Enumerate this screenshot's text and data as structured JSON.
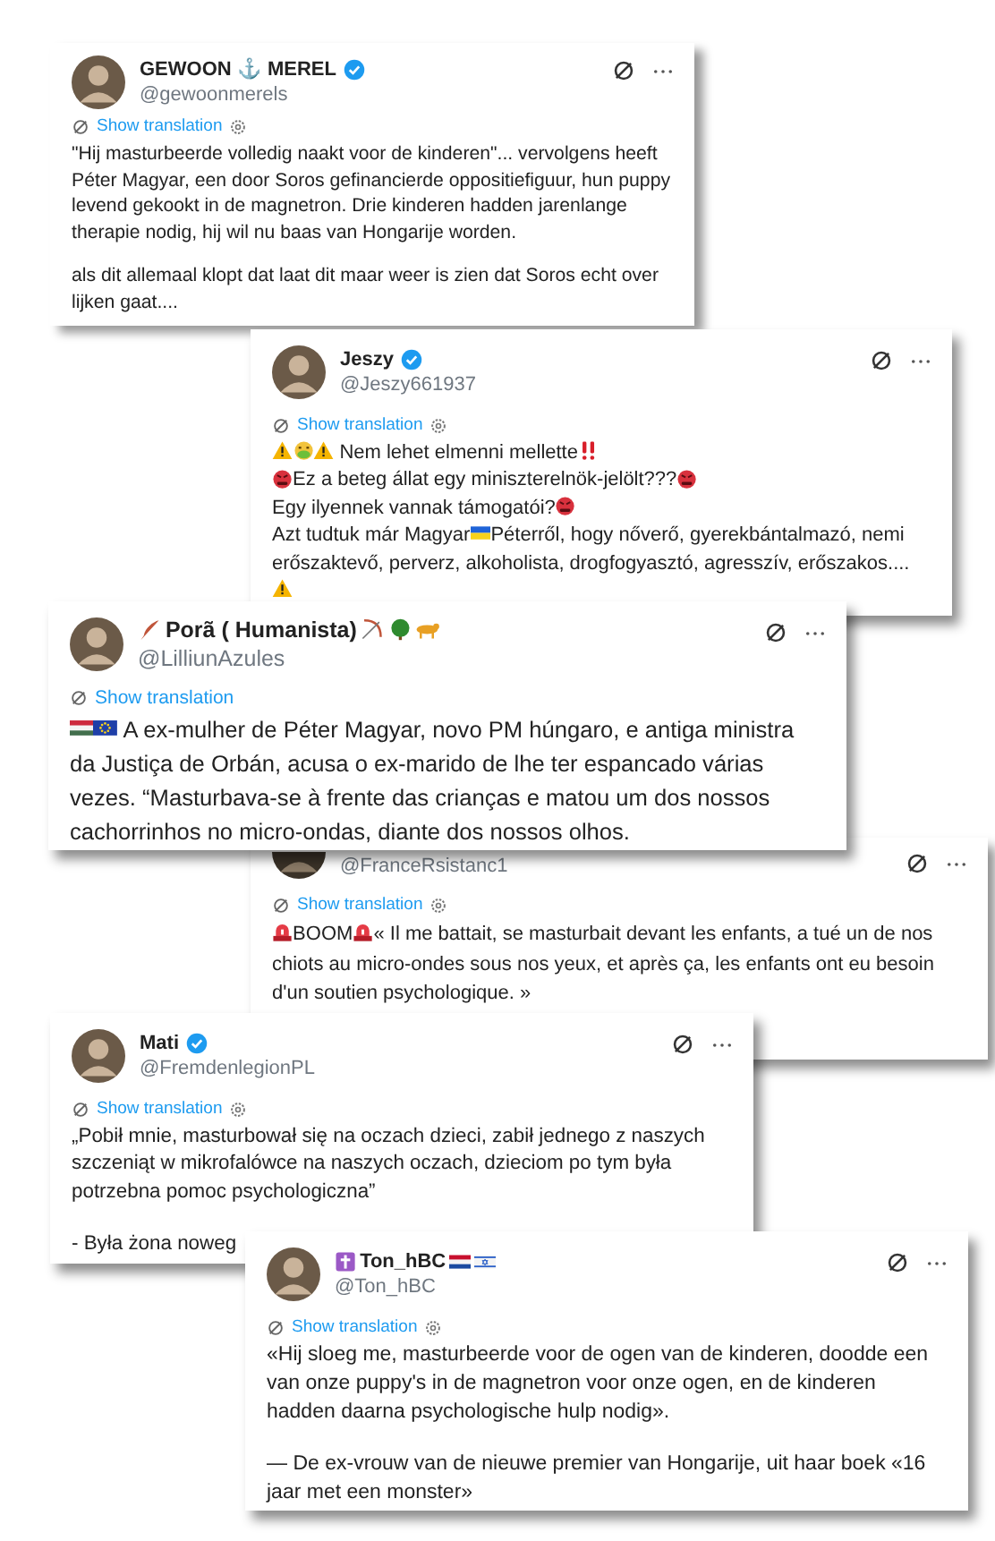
{
  "posts": [
    {
      "name_parts": [
        {
          "kind": "text",
          "text": "GEWOON ⚓ MEREL"
        }
      ],
      "verified": true,
      "handle": "@gewoonmerels",
      "translation": "Show translation",
      "settings_icon": true,
      "body": [
        [
          {
            "kind": "text",
            "text": "\"Hij masturbeerde volledig naakt voor de kinderen\"... vervolgens heeft Péter Magyar, een door Soros gefinancierde oppositiefiguur, hun puppy levend gekookt in de magnetron. Drie kinderen hadden jarenlange therapie nodig, hij wil nu baas van Hongarije worden."
          }
        ],
        [
          {
            "kind": "text",
            "text": "als dit allemaal klopt dat laat dit maar weer is zien dat Soros echt over lijken gaat...."
          }
        ]
      ]
    },
    {
      "name_parts": [
        {
          "kind": "text",
          "text": "Jeszy"
        }
      ],
      "verified": true,
      "handle": "@Jeszy661937",
      "translation": "Show translation",
      "settings_icon": true,
      "body": [
        [
          {
            "kind": "warning"
          },
          {
            "kind": "vomit"
          },
          {
            "kind": "warning"
          },
          {
            "kind": "text",
            "text": " Nem lehet elmenni mellette"
          },
          {
            "kind": "bangbang"
          },
          {
            "kind": "break"
          },
          {
            "kind": "angry"
          },
          {
            "kind": "text",
            "text": "Ez a beteg állat egy miniszterelnök-jelölt???"
          },
          {
            "kind": "angry"
          },
          {
            "kind": "break"
          },
          {
            "kind": "text",
            "text": "Egy ilyennek vannak támogatói?"
          },
          {
            "kind": "angry"
          },
          {
            "kind": "break"
          },
          {
            "kind": "text",
            "text": "Azt tudtuk már Magyar"
          },
          {
            "kind": "flag-ua"
          },
          {
            "kind": "text",
            "text": "Péterről, hogy nőverő, gyerekbántalmazó, nemi erőszaktevő, perverz, alkoholista, drogfogyasztó, agresszív, erőszakos...."
          },
          {
            "kind": "break"
          },
          {
            "kind": "warning"
          }
        ]
      ]
    },
    {
      "name_parts": [
        {
          "kind": "feather"
        },
        {
          "kind": "text",
          "text": "Porã ( Humanista)"
        },
        {
          "kind": "bow"
        },
        {
          "kind": "tree"
        },
        {
          "kind": "jaguar"
        }
      ],
      "verified": false,
      "handle": "@LilliunAzules",
      "translation": "Show translation",
      "settings_icon": false,
      "body": [
        [
          {
            "kind": "flag-hu"
          },
          {
            "kind": "flag-eu"
          },
          {
            "kind": "text",
            "text": " A ex-mulher de Péter Magyar, novo PM húngaro, e antiga ministra da Justiça de Orbán, acusa o ex-marido de lhe ter espancado várias vezes. “Masturbava-se à frente das crianças e matou um dos nossos cachorrinhos no micro-ondas, diante dos nossos olhos."
          }
        ]
      ]
    },
    {
      "verified": false,
      "handle": "@FranceRsistanc1",
      "translation": "Show translation",
      "settings_icon": true,
      "body": [
        [
          {
            "kind": "siren"
          },
          {
            "kind": "text",
            "text": "BOOM"
          },
          {
            "kind": "siren"
          },
          {
            "kind": "text",
            "text": "« Il me battait, se masturbait devant les enfants, a tué un de nos chiots au micro-ondes sous nos yeux, et après ça, les enfants ont eu besoin d'un soutien psychologique. »"
          }
        ]
      ]
    },
    {
      "name_parts": [
        {
          "kind": "text",
          "text": "Mati"
        }
      ],
      "verified": true,
      "handle": "@FremdenlegionPL",
      "translation": "Show translation",
      "settings_icon": true,
      "body": [
        [
          {
            "kind": "text",
            "text": "„Pobił mnie, masturbował się na oczach dzieci, zabił jednego z naszych szczeniąt w mikrofalówce na naszych oczach, dzieciom po tym była potrzebna pomoc psychologiczna”"
          }
        ],
        [
          {
            "kind": "text",
            "text": "- Była żona noweg"
          }
        ]
      ]
    },
    {
      "name_parts": [
        {
          "kind": "cross"
        },
        {
          "kind": "text",
          "text": "Ton_hBC"
        },
        {
          "kind": "flag-nl"
        },
        {
          "kind": "flag-il"
        }
      ],
      "verified": false,
      "handle": "@Ton_hBC",
      "translation": "Show translation",
      "settings_icon": true,
      "body": [
        [
          {
            "kind": "text",
            "text": "«Hij sloeg me, masturbeerde voor de ogen van de kinderen, doodde een van onze puppy's in de magnetron voor onze ogen, en de kinderen hadden daarna psychologische hulp nodig»."
          }
        ],
        [
          {
            "kind": "text",
            "text": "— De ex-vrouw van de nieuwe premier van Hongarije, uit haar boek «16 jaar met een monster»"
          }
        ]
      ]
    }
  ]
}
